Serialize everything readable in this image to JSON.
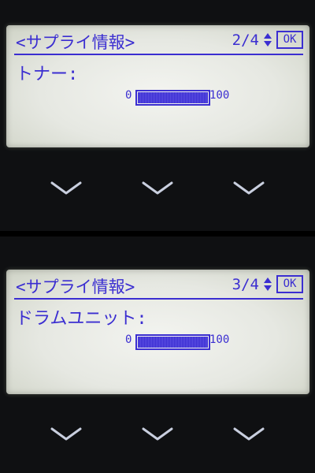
{
  "screens": [
    {
      "title": "<サプライ情報>",
      "page": "2/4",
      "ok_label": "OK",
      "item_label": "トナー:",
      "gauge_min": "0",
      "gauge_max": "100",
      "level_percent": 100
    },
    {
      "title": "<サプライ情報>",
      "page": "3/4",
      "ok_label": "OK",
      "item_label": "ドラムユニット:",
      "gauge_min": "0",
      "gauge_max": "100",
      "level_percent": 100
    }
  ],
  "colors": {
    "lcd_text": "#3b2ed1",
    "lcd_background": "#e8e9e4",
    "bezel": "#0f1012",
    "chevron": "#c9cfdf"
  },
  "icons": {
    "scroll": "up-down-arrows-icon",
    "nav_buttons": [
      "chevron-down-icon",
      "chevron-down-icon",
      "chevron-down-icon"
    ]
  }
}
